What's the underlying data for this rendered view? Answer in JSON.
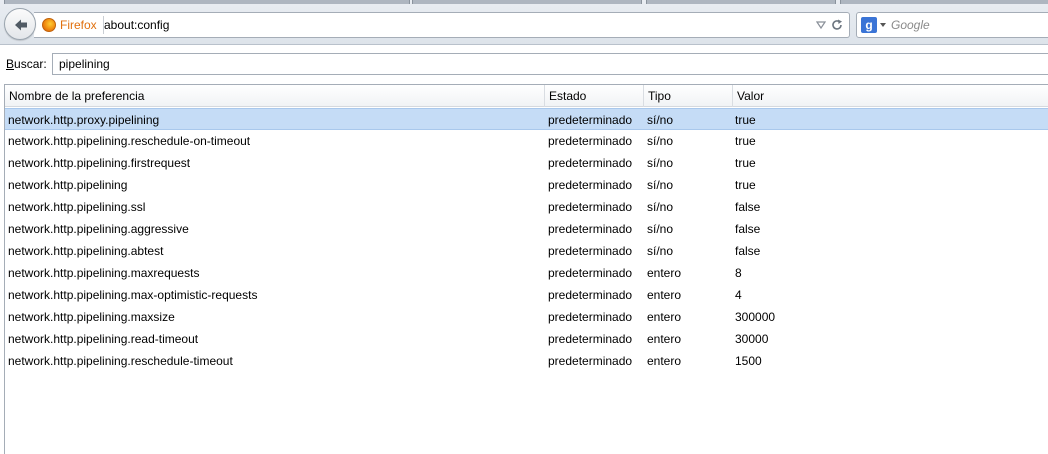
{
  "browser": {
    "identity_label": "Firefox",
    "url": "about:config",
    "search_engine_icon": "google-icon",
    "search_placeholder": "Google"
  },
  "filter": {
    "label_accesskey": "B",
    "label_rest": "uscar:",
    "value": "pipelining"
  },
  "columns": {
    "name": "Nombre de la preferencia",
    "state": "Estado",
    "type": "Tipo",
    "value": "Valor"
  },
  "prefs": [
    {
      "name": "network.http.proxy.pipelining",
      "state": "predeterminado",
      "type": "sí/no",
      "value": "true"
    },
    {
      "name": "network.http.pipelining.reschedule-on-timeout",
      "state": "predeterminado",
      "type": "sí/no",
      "value": "true"
    },
    {
      "name": "network.http.pipelining.firstrequest",
      "state": "predeterminado",
      "type": "sí/no",
      "value": "true"
    },
    {
      "name": "network.http.pipelining",
      "state": "predeterminado",
      "type": "sí/no",
      "value": "true"
    },
    {
      "name": "network.http.pipelining.ssl",
      "state": "predeterminado",
      "type": "sí/no",
      "value": "false"
    },
    {
      "name": "network.http.pipelining.aggressive",
      "state": "predeterminado",
      "type": "sí/no",
      "value": "false"
    },
    {
      "name": "network.http.pipelining.abtest",
      "state": "predeterminado",
      "type": "sí/no",
      "value": "false"
    },
    {
      "name": "network.http.pipelining.maxrequests",
      "state": "predeterminado",
      "type": "entero",
      "value": "8"
    },
    {
      "name": "network.http.pipelining.max-optimistic-requests",
      "state": "predeterminado",
      "type": "entero",
      "value": "4"
    },
    {
      "name": "network.http.pipelining.maxsize",
      "state": "predeterminado",
      "type": "entero",
      "value": "300000"
    },
    {
      "name": "network.http.pipelining.read-timeout",
      "state": "predeterminado",
      "type": "entero",
      "value": "30000"
    },
    {
      "name": "network.http.pipelining.reschedule-timeout",
      "state": "predeterminado",
      "type": "entero",
      "value": "1500"
    }
  ],
  "colors": {
    "selection": "#c5dcf6",
    "firefox_label": "#e0700e"
  }
}
